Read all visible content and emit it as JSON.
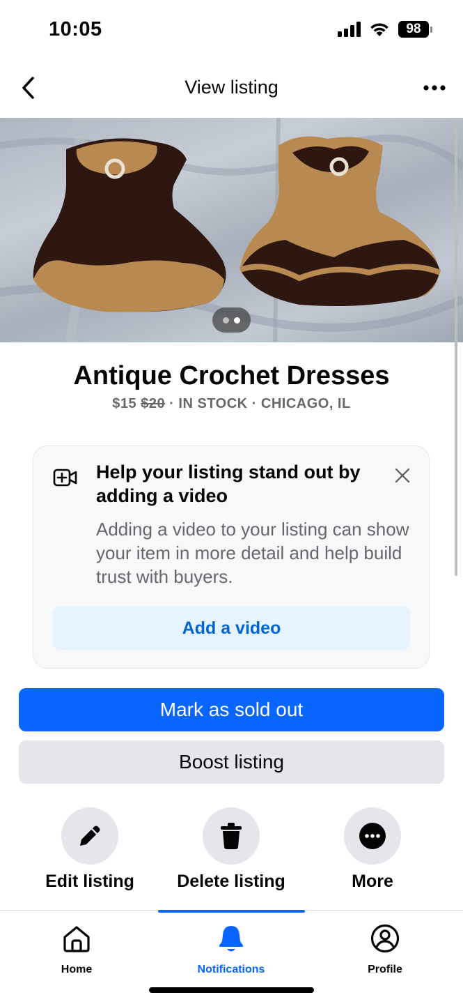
{
  "status_bar": {
    "time": "10:05",
    "battery": "98"
  },
  "header": {
    "title": "View listing"
  },
  "photo": {
    "image_count": 2,
    "active_index": 1
  },
  "listing": {
    "title": "Antique Crochet Dresses",
    "price": "$15",
    "original_price": "$20",
    "status": "· IN STOCK",
    "location": "· CHICAGO, IL"
  },
  "video_card": {
    "heading": "Help your listing stand out by adding a video",
    "body": "Adding a video to your listing can show your item in more detail and help build trust with buyers.",
    "button": "Add a video"
  },
  "buttons": {
    "primary": "Mark as sold out",
    "secondary": "Boost listing"
  },
  "actions": [
    {
      "label": "Edit listing",
      "icon": "pencil-icon"
    },
    {
      "label": "Delete listing",
      "icon": "trash-icon"
    },
    {
      "label": "More",
      "icon": "more-icon"
    }
  ],
  "tabs": [
    {
      "label": "Home",
      "icon": "home-icon"
    },
    {
      "label": "Notifications",
      "icon": "bell-icon",
      "active": true
    },
    {
      "label": "Profile",
      "icon": "profile-icon"
    }
  ],
  "colors": {
    "accent": "#0866ff",
    "link": "#0064d1",
    "muted": "#65676b",
    "light_button": "#e4e6eb"
  }
}
